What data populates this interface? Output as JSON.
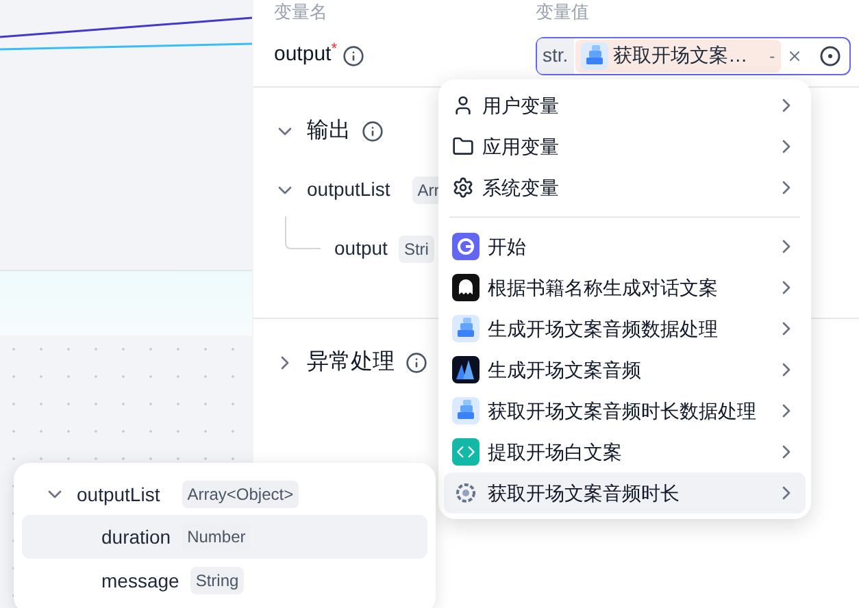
{
  "panel": {
    "name_header": "变量名",
    "value_header": "变量值",
    "variable": {
      "name": "output",
      "required_mark": "*",
      "type_tag": "str.",
      "value": "获取开场文案…",
      "value_suffix": "-"
    },
    "output_section": {
      "title": "输出",
      "expanded": true,
      "tree": [
        {
          "name": "outputList",
          "type": "Arr",
          "expanded": true,
          "children": [
            {
              "name": "output",
              "type": "Stri"
            }
          ]
        }
      ]
    },
    "error_section": {
      "title": "异常处理",
      "expanded": false
    }
  },
  "menu": {
    "items": [
      {
        "kind": "user",
        "label": "用户变量",
        "selected": false
      },
      {
        "kind": "folder",
        "label": "应用变量",
        "selected": false
      },
      {
        "kind": "gear",
        "label": "系统变量",
        "selected": false
      },
      {
        "kind": "start",
        "label": "开始",
        "selected": false
      },
      {
        "kind": "chat",
        "label": "根据书籍名称生成对话文案",
        "selected": false
      },
      {
        "kind": "data",
        "label": "生成开场文案音频数据处理",
        "selected": false
      },
      {
        "kind": "audio",
        "label": "生成开场文案音频",
        "selected": false
      },
      {
        "kind": "data",
        "label": "获取开场文案音频时长数据处理",
        "selected": false
      },
      {
        "kind": "code",
        "label": "提取开场白文案",
        "selected": false
      },
      {
        "kind": "model",
        "label": "获取开场文案音频时长",
        "selected": true
      }
    ]
  },
  "submenu": {
    "root": {
      "name": "outputList",
      "type": "Array<Object>",
      "expanded": true
    },
    "children": [
      {
        "name": "duration",
        "type": "Number",
        "selected": true
      },
      {
        "name": "message",
        "type": "String",
        "selected": false
      }
    ]
  }
}
